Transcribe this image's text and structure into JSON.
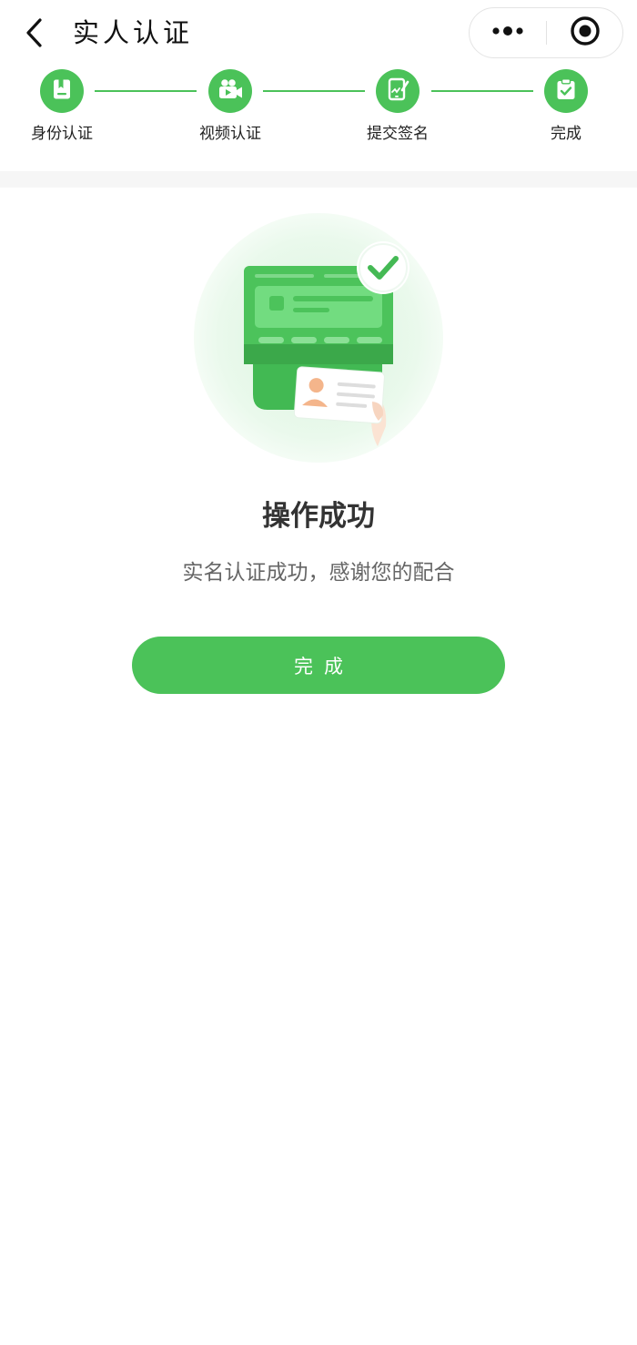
{
  "navbar": {
    "title": "实人认证",
    "back_icon": "chevron-left-icon",
    "more_icon": "more-dots-icon",
    "close_icon": "target-circle-icon"
  },
  "steps": [
    {
      "label": "身份认证",
      "icon": "id-card-icon"
    },
    {
      "label": "视频认证",
      "icon": "video-camera-icon"
    },
    {
      "label": "提交签名",
      "icon": "tablet-signature-icon"
    },
    {
      "label": "完成",
      "icon": "clipboard-check-icon"
    }
  ],
  "result": {
    "title": "操作成功",
    "description": "实名认证成功，感谢您的配合",
    "illustration_icon": "id-card-reader-success-icon"
  },
  "actions": {
    "done_label": "完成"
  },
  "colors": {
    "accent": "#4bc259",
    "accent_dark": "#3aa548",
    "accent_light": "#e8f8ea",
    "text_primary": "#333333",
    "text_secondary": "#666666",
    "band": "#f6f6f6"
  }
}
